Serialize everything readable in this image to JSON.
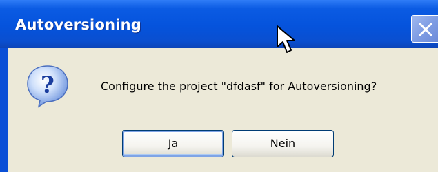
{
  "window": {
    "title": "Autoversioning"
  },
  "dialog": {
    "message": "Configure the project \"dfdasf\" for Autoversioning?",
    "icon": "question-icon"
  },
  "buttons": {
    "yes_label": "Ja",
    "no_label": "Nein"
  },
  "colors": {
    "titlebar": "#0553dc",
    "client_bg": "#ece9d8",
    "button_border": "#003c74"
  }
}
